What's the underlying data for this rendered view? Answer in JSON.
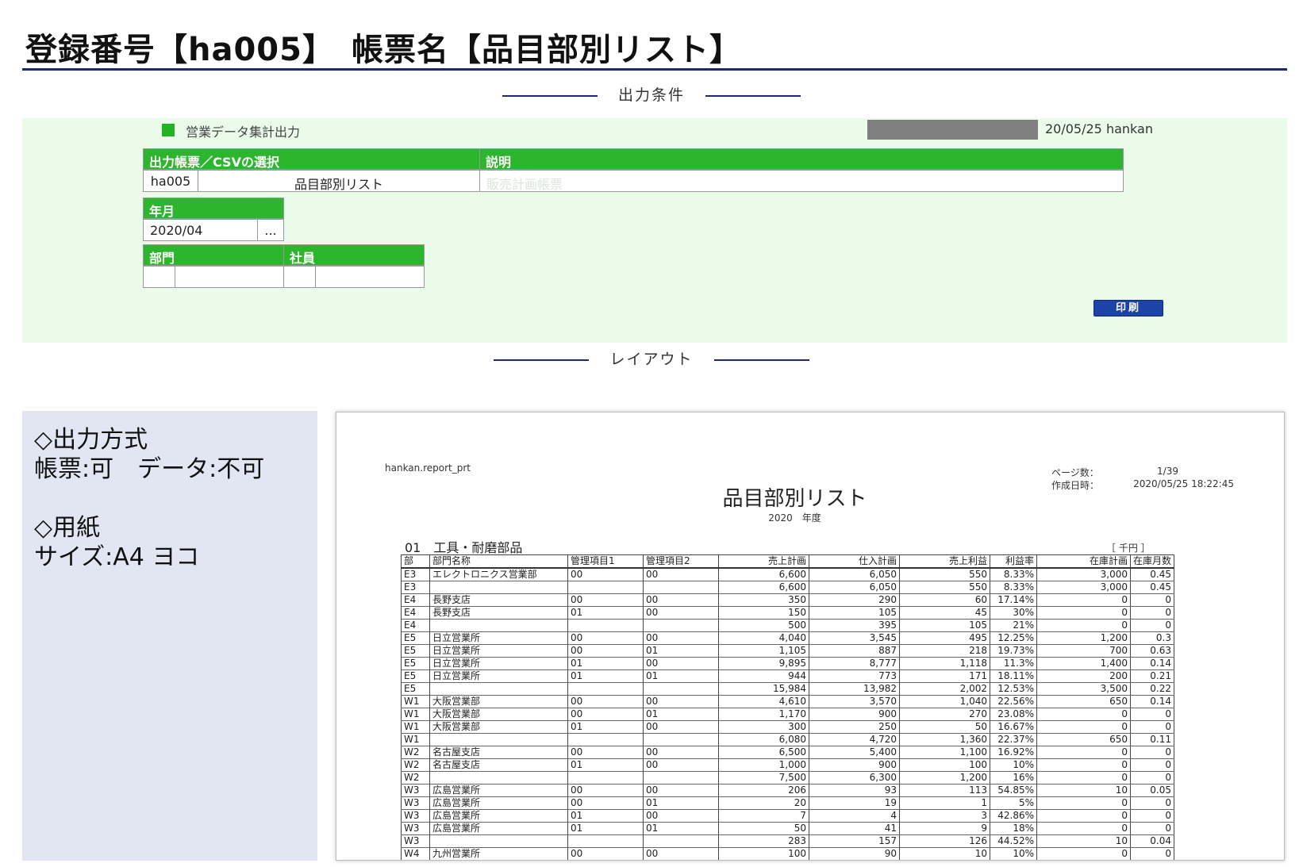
{
  "header": {
    "title": "登録番号【ha005】　帳票名【品目部別リスト】"
  },
  "sections": {
    "conditions_label": "出力条件",
    "layout_label": "レイアウト"
  },
  "conditions": {
    "heading": "営業データ集計出力",
    "datetime_user": "20/05/25 hankan",
    "form_select_label": "出力帳票／CSVの選択",
    "description_label": "説明",
    "form_code": "ha005",
    "form_name": "品目部別リスト",
    "description_value": "販売計画帳票",
    "year_month_label": "年月",
    "year_month_value": "2020/04",
    "picker_label": "...",
    "department_label": "部門",
    "employee_label": "社員",
    "department_code": "",
    "department_name": "",
    "employee_code": "",
    "employee_name": "",
    "print_label": "印刷"
  },
  "info": {
    "output_method_heading": "◇出力方式",
    "output_method_value": "帳票:可　データ:不可",
    "paper_heading": "◇用紙",
    "paper_value": "サイズ:A4 ヨコ"
  },
  "report": {
    "program": "hankan.report_prt",
    "pages_label": "ページ数：",
    "pages_value": "1/39",
    "created_label": "作成日時：",
    "created_value": "2020/05/25 18:22:45",
    "title": "品目部別リスト",
    "year": "2020　年度",
    "section_code": "01",
    "section_name": "工具・耐磨部品",
    "unit": "［ 千円 ］",
    "columns": [
      "部",
      "部門名称",
      "管理項目1",
      "管理項目2",
      "売上計画",
      "仕入計画",
      "売上利益",
      "利益率",
      "在庫計画",
      "在庫月数"
    ],
    "rows": [
      [
        "E3",
        "エレクトロニクス営業部",
        "00",
        "00",
        "6,600",
        "6,050",
        "550",
        "8.33%",
        "3,000",
        "0.45"
      ],
      [
        "E3",
        "",
        "",
        "",
        "6,600",
        "6,050",
        "550",
        "8.33%",
        "3,000",
        "0.45"
      ],
      [
        "E4",
        "長野支店",
        "00",
        "00",
        "350",
        "290",
        "60",
        "17.14%",
        "0",
        "0"
      ],
      [
        "E4",
        "長野支店",
        "01",
        "00",
        "150",
        "105",
        "45",
        "30%",
        "0",
        "0"
      ],
      [
        "E4",
        "",
        "",
        "",
        "500",
        "395",
        "105",
        "21%",
        "0",
        "0"
      ],
      [
        "E5",
        "日立営業所",
        "00",
        "00",
        "4,040",
        "3,545",
        "495",
        "12.25%",
        "1,200",
        "0.3"
      ],
      [
        "E5",
        "日立営業所",
        "00",
        "01",
        "1,105",
        "887",
        "218",
        "19.73%",
        "700",
        "0.63"
      ],
      [
        "E5",
        "日立営業所",
        "01",
        "00",
        "9,895",
        "8,777",
        "1,118",
        "11.3%",
        "1,400",
        "0.14"
      ],
      [
        "E5",
        "日立営業所",
        "01",
        "01",
        "944",
        "773",
        "171",
        "18.11%",
        "200",
        "0.21"
      ],
      [
        "E5",
        "",
        "",
        "",
        "15,984",
        "13,982",
        "2,002",
        "12.53%",
        "3,500",
        "0.22"
      ],
      [
        "W1",
        "大阪営業部",
        "00",
        "00",
        "4,610",
        "3,570",
        "1,040",
        "22.56%",
        "650",
        "0.14"
      ],
      [
        "W1",
        "大阪営業部",
        "00",
        "01",
        "1,170",
        "900",
        "270",
        "23.08%",
        "0",
        "0"
      ],
      [
        "W1",
        "大阪営業部",
        "01",
        "00",
        "300",
        "250",
        "50",
        "16.67%",
        "0",
        "0"
      ],
      [
        "W1",
        "",
        "",
        "",
        "6,080",
        "4,720",
        "1,360",
        "22.37%",
        "650",
        "0.11"
      ],
      [
        "W2",
        "名古屋支店",
        "00",
        "00",
        "6,500",
        "5,400",
        "1,100",
        "16.92%",
        "0",
        "0"
      ],
      [
        "W2",
        "名古屋支店",
        "01",
        "00",
        "1,000",
        "900",
        "100",
        "10%",
        "0",
        "0"
      ],
      [
        "W2",
        "",
        "",
        "",
        "7,500",
        "6,300",
        "1,200",
        "16%",
        "0",
        "0"
      ],
      [
        "W3",
        "広島営業所",
        "00",
        "00",
        "206",
        "93",
        "113",
        "54.85%",
        "10",
        "0.05"
      ],
      [
        "W3",
        "広島営業所",
        "00",
        "01",
        "20",
        "19",
        "1",
        "5%",
        "0",
        "0"
      ],
      [
        "W3",
        "広島営業所",
        "01",
        "00",
        "7",
        "4",
        "3",
        "42.86%",
        "0",
        "0"
      ],
      [
        "W3",
        "広島営業所",
        "01",
        "01",
        "50",
        "41",
        "9",
        "18%",
        "0",
        "0"
      ],
      [
        "W3",
        "",
        "",
        "",
        "283",
        "157",
        "126",
        "44.52%",
        "10",
        "0.04"
      ],
      [
        "W4",
        "九州営業所",
        "00",
        "00",
        "100",
        "90",
        "10",
        "10%",
        "0",
        "0"
      ]
    ]
  },
  "colors": {
    "accent_green": "#2db52d",
    "panel_green": "#eafbea",
    "navy": "#1a2a6c",
    "button_blue": "#1d43a8",
    "info_panel": "#e1e6f2"
  }
}
